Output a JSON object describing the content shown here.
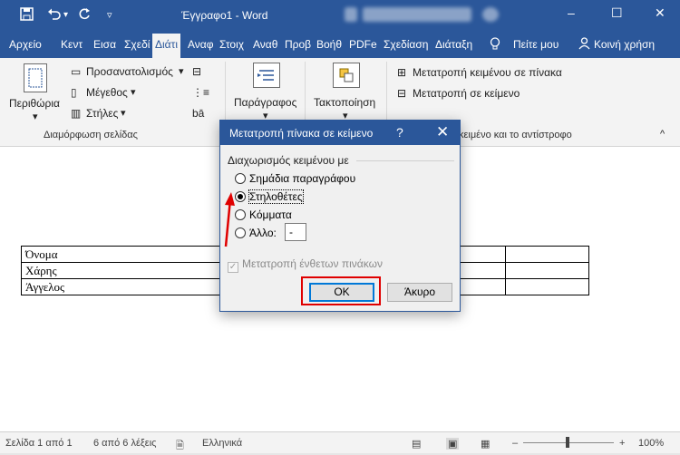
{
  "window": {
    "title": "Έγγραφο1 - Word",
    "save_icon": "save-icon",
    "undo_icon": "undo-icon",
    "redo_icon": "redo-icon",
    "customize_icon": "chevron-down-icon",
    "minimize": "–",
    "restore": "☐",
    "close": "✕"
  },
  "tabs": [
    {
      "label": "Αρχείο"
    },
    {
      "label": "Κεντ"
    },
    {
      "label": "Εισα"
    },
    {
      "label": "Σχεδί"
    },
    {
      "label": "Διάτι"
    },
    {
      "label": "Αναφ"
    },
    {
      "label": "Στοιχ"
    },
    {
      "label": "Αναθ"
    },
    {
      "label": "Προβ"
    },
    {
      "label": "Βοήθ"
    },
    {
      "label": "PDFe"
    },
    {
      "label": "Σχεδίαση"
    },
    {
      "label": "Διάταξη"
    },
    {
      "label": "Πείτε μου"
    },
    {
      "label": "Κοινή χρήση"
    }
  ],
  "ribbon": {
    "margins_label": "Περιθώρια",
    "orientation_label": "Προσανατολισμός",
    "size_label": "Μέγεθος",
    "columns_label": "Στήλες",
    "page_setup_group": "Διαμόρφωση σελίδας",
    "paragraph_label": "Παράγραφος",
    "arrange_label": "Τακτοποίηση",
    "convert_table_to_text": "Μετατροπή κειμένου σε πίνακα",
    "convert_to_text": "Μετατροπή σε κείμενο",
    "group_tail_label": "κειμένο και το αντίστροφο"
  },
  "document": {
    "rows": [
      [
        "Όνομα",
        ""
      ],
      [
        "Χάρης",
        ""
      ],
      [
        "Άγγελος",
        ""
      ]
    ]
  },
  "dialog": {
    "title": "Μετατροπή πίνακα σε κείμενο",
    "help": "?",
    "close": "✕",
    "section_label": "Διαχωρισμός κειμένου με",
    "options": [
      {
        "label": "Σημάδια παραγράφου",
        "selected": false
      },
      {
        "label": "Στηλοθέτες",
        "selected": true
      },
      {
        "label": "Κόμματα",
        "selected": false
      },
      {
        "label": "Άλλο:",
        "selected": false
      }
    ],
    "other_value": "-",
    "nested_checkbox_label": "Μετατροπή ένθετων πινάκων",
    "ok_label": "OK",
    "cancel_label": "Άκυρο"
  },
  "statusbar": {
    "page": "Σελίδα 1 από 1",
    "words": "6 από 6 λέξεις",
    "language": "Ελληνικά",
    "zoom": "100%"
  },
  "colors": {
    "brand": "#2b579a",
    "highlight": "#e00000"
  }
}
